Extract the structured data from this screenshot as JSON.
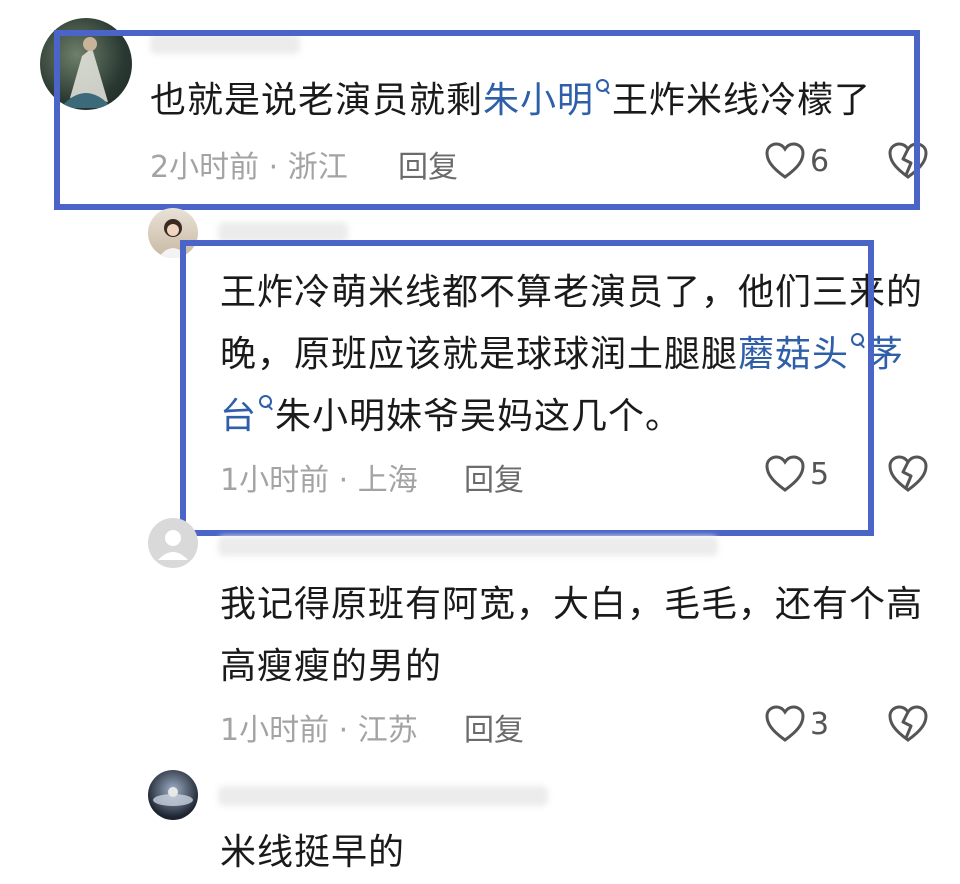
{
  "comments": [
    {
      "text_before": "也就是说老演员就剩",
      "link1": "朱小明",
      "text_after": "王炸米线冷檬了",
      "time_location": "2小时前 · 浙江",
      "reply_label": "回复",
      "likes": "6"
    },
    {
      "line1": "王炸冷萌米线都不算老演员了，他们三来的",
      "line2_before": "晚，原班应该就是球球润土腿腿",
      "link1": "蘑菇头",
      "link2_part1": "茅",
      "link2_part2": "台",
      "line3_after": "朱小明妹爷吴妈这几个。",
      "time_location": "1小时前 · 上海",
      "reply_label": "回复",
      "likes": "5"
    },
    {
      "line1": "我记得原班有阿宽，大白，毛毛，还有个高",
      "line2": "高瘦瘦的男的",
      "time_location": "1小时前 · 江苏",
      "reply_label": "回复",
      "likes": "3"
    },
    {
      "line1": "米线挺早的"
    }
  ],
  "icons": {
    "like": "heart-outline-icon",
    "dislike": "broken-heart-icon",
    "search_hint": "search-icon"
  },
  "colors": {
    "link": "#2e5fa8",
    "highlight_box": "#4a64c8",
    "meta_text": "#a3a3a3"
  }
}
